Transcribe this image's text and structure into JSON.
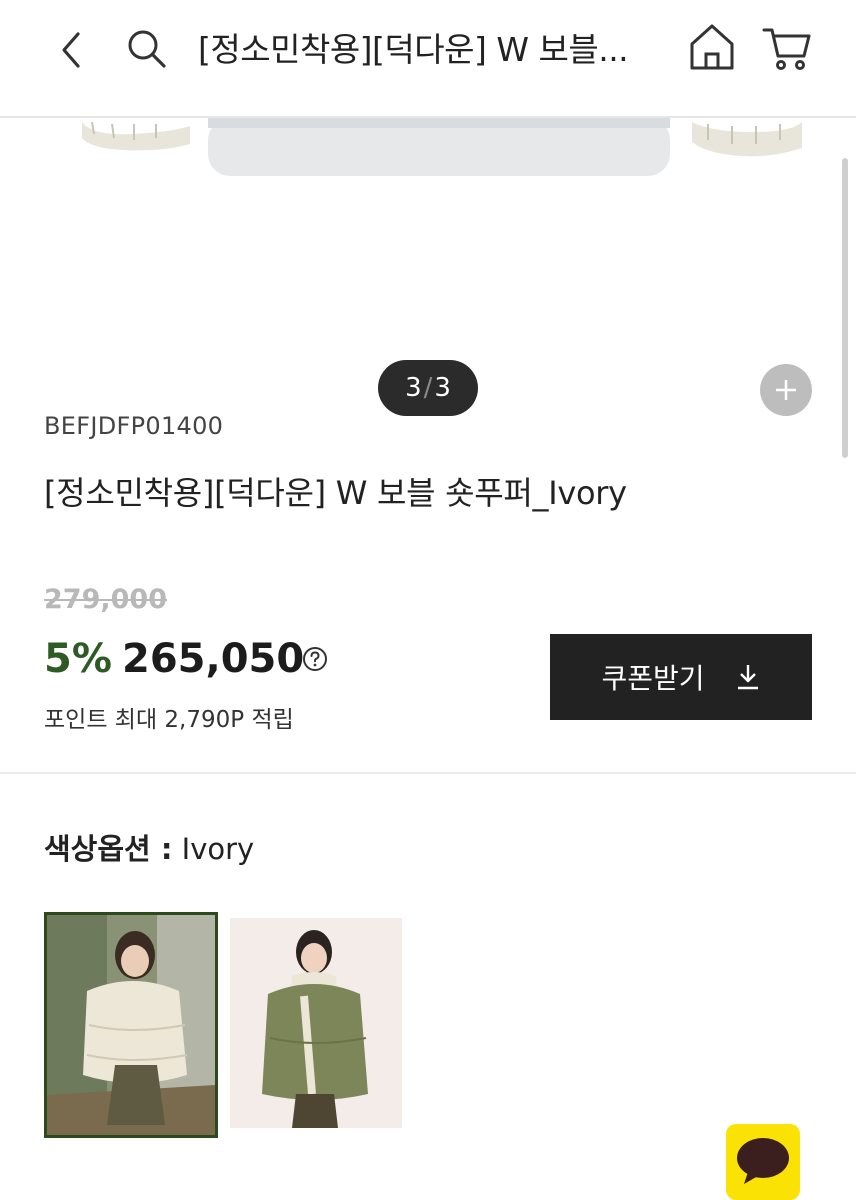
{
  "header": {
    "title": "[정소민착용][덕다운] W 보블...",
    "back_icon": "chevron-left-icon",
    "search_icon": "search-icon",
    "home_icon": "home-icon",
    "cart_icon": "cart-icon"
  },
  "carousel": {
    "current": "3",
    "separator": "/",
    "total": "3",
    "zoom_icon": "plus-icon"
  },
  "product": {
    "sku": "BEFJDFP01400",
    "name": "[정소민착용][덕다운] W 보블 숏푸퍼_Ivory",
    "original_price": "279,000",
    "discount_rate": "5%",
    "sale_price": "265,050",
    "points_text": "포인트 최대 2,790P 적립"
  },
  "coupon": {
    "label": "쿠폰받기",
    "icon": "download-icon"
  },
  "color_option": {
    "label": "색상옵션 :",
    "selected": "Ivory",
    "swatches": [
      {
        "name": "Ivory",
        "selected": true
      },
      {
        "name": "Khaki",
        "selected": false
      }
    ]
  },
  "colors": {
    "accent_green": "#2e5a26",
    "dark_button": "#222222",
    "chat_yellow": "#fbe205"
  },
  "chat": {
    "icon": "chat-bubble-icon"
  }
}
